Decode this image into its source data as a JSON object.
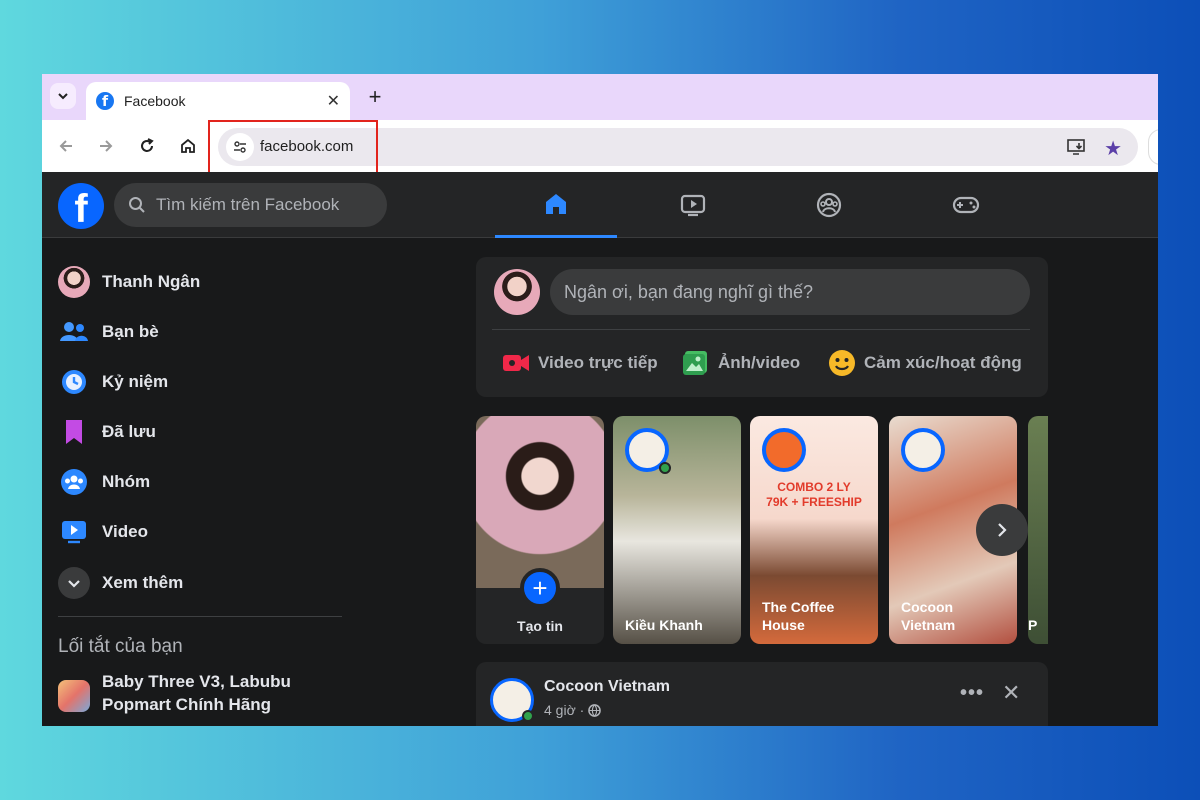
{
  "browser": {
    "tab_title": "Facebook",
    "tab_close": "✕",
    "new_tab": "+",
    "url": "facebook.com"
  },
  "facebook": {
    "search_placeholder": "Tìm kiếm trên Facebook",
    "nav_tabs": [
      "home",
      "watch",
      "groups",
      "gaming"
    ],
    "sidebar": {
      "items": [
        {
          "label": "Thanh Ngân",
          "icon": "profile-avatar"
        },
        {
          "label": "Bạn bè",
          "icon": "friends-icon"
        },
        {
          "label": "Kỷ niệm",
          "icon": "memories-icon"
        },
        {
          "label": "Đã lưu",
          "icon": "saved-icon"
        },
        {
          "label": "Nhóm",
          "icon": "groups-icon"
        },
        {
          "label": "Video",
          "icon": "video-icon"
        },
        {
          "label": "Xem thêm",
          "icon": "chevron-down-icon"
        }
      ],
      "shortcuts_heading": "Lối tắt của bạn",
      "shortcut": "Baby Three V3, Labubu Popmart Chính Hãng"
    },
    "composer": {
      "placeholder": "Ngân ơi, bạn đang nghĩ gì thế?",
      "actions": [
        "Video trực tiếp",
        "Ảnh/video",
        "Cảm xúc/hoạt động"
      ]
    },
    "stories": {
      "create_label": "Tạo tin",
      "items": [
        {
          "name": "Kiều Khanh"
        },
        {
          "name": "The Coffee House",
          "promo_line1": "COMBO 2 LY",
          "promo_line2": "79K + FREESHIP"
        },
        {
          "name": "Cocoon Vietnam"
        }
      ],
      "partial_letter": "P"
    },
    "post": {
      "author": "Cocoon Vietnam",
      "time": "4 giờ ·",
      "more": "•••",
      "close": "✕"
    }
  },
  "colors": {
    "accent": "#0866ff",
    "highlight_box": "#e2241d",
    "fb_dark_bg": "#18191a",
    "fb_card": "#242526"
  }
}
